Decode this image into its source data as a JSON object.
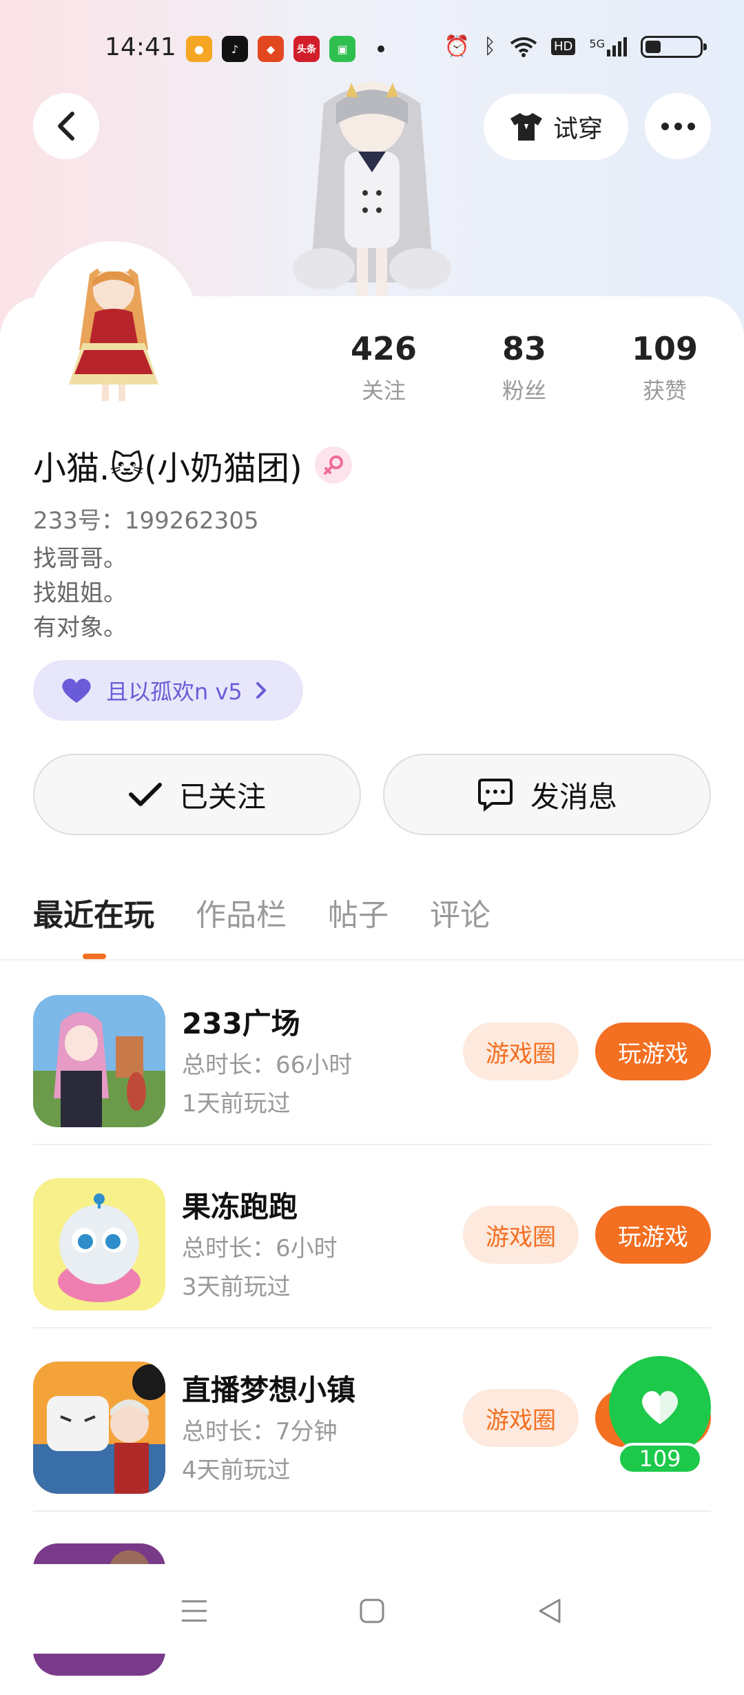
{
  "status_bar": {
    "time": "14:41",
    "network": "5G",
    "hd_label": "HD",
    "notification_apps": [
      {
        "name": "weibo-icon",
        "color": "#f5a623"
      },
      {
        "name": "tiktok-icon",
        "color": "#111111"
      },
      {
        "name": "app-icon",
        "color": "#e2471f"
      },
      {
        "name": "toutiao-icon",
        "color": "#d21e2b",
        "label": "头条"
      },
      {
        "name": "messages-icon",
        "color": "#2fbf4f"
      }
    ]
  },
  "header": {
    "tryon_label": "试穿"
  },
  "profile": {
    "stats": [
      {
        "value": "426",
        "label": "关注"
      },
      {
        "value": "83",
        "label": "粉丝"
      },
      {
        "value": "109",
        "label": "获赞"
      }
    ],
    "username": "小猫.🐱(小奶猫团)",
    "user_id": "233号：199262305",
    "bio": [
      "找哥哥。",
      "找姐姐。",
      "有对象。"
    ],
    "guild": "且以孤欢n v5"
  },
  "actions": {
    "follow_label": "已关注",
    "message_label": "发消息"
  },
  "tabs": [
    "最近在玩",
    "作品栏",
    "帖子",
    "评论"
  ],
  "games": [
    {
      "name": "233广场",
      "duration": "总时长：66小时",
      "last_played": "1天前玩过",
      "circle_label": "游戏圈",
      "play_label": "玩游戏"
    },
    {
      "name": "果冻跑跑",
      "duration": "总时长：6小时",
      "last_played": "3天前玩过",
      "circle_label": "游戏圈",
      "play_label": "玩游戏"
    },
    {
      "name": "直播梦想小镇",
      "duration": "总时长：7分钟",
      "last_played": "4天前玩过",
      "circle_label": "游戏圈",
      "play_label": "玩游戏"
    }
  ],
  "like_float": {
    "count": "109"
  },
  "colors": {
    "accent": "#f36f21",
    "accent_soft": "#fde9dd",
    "like_green": "#1dc94a",
    "guild_purple": "#6a5bd8"
  }
}
